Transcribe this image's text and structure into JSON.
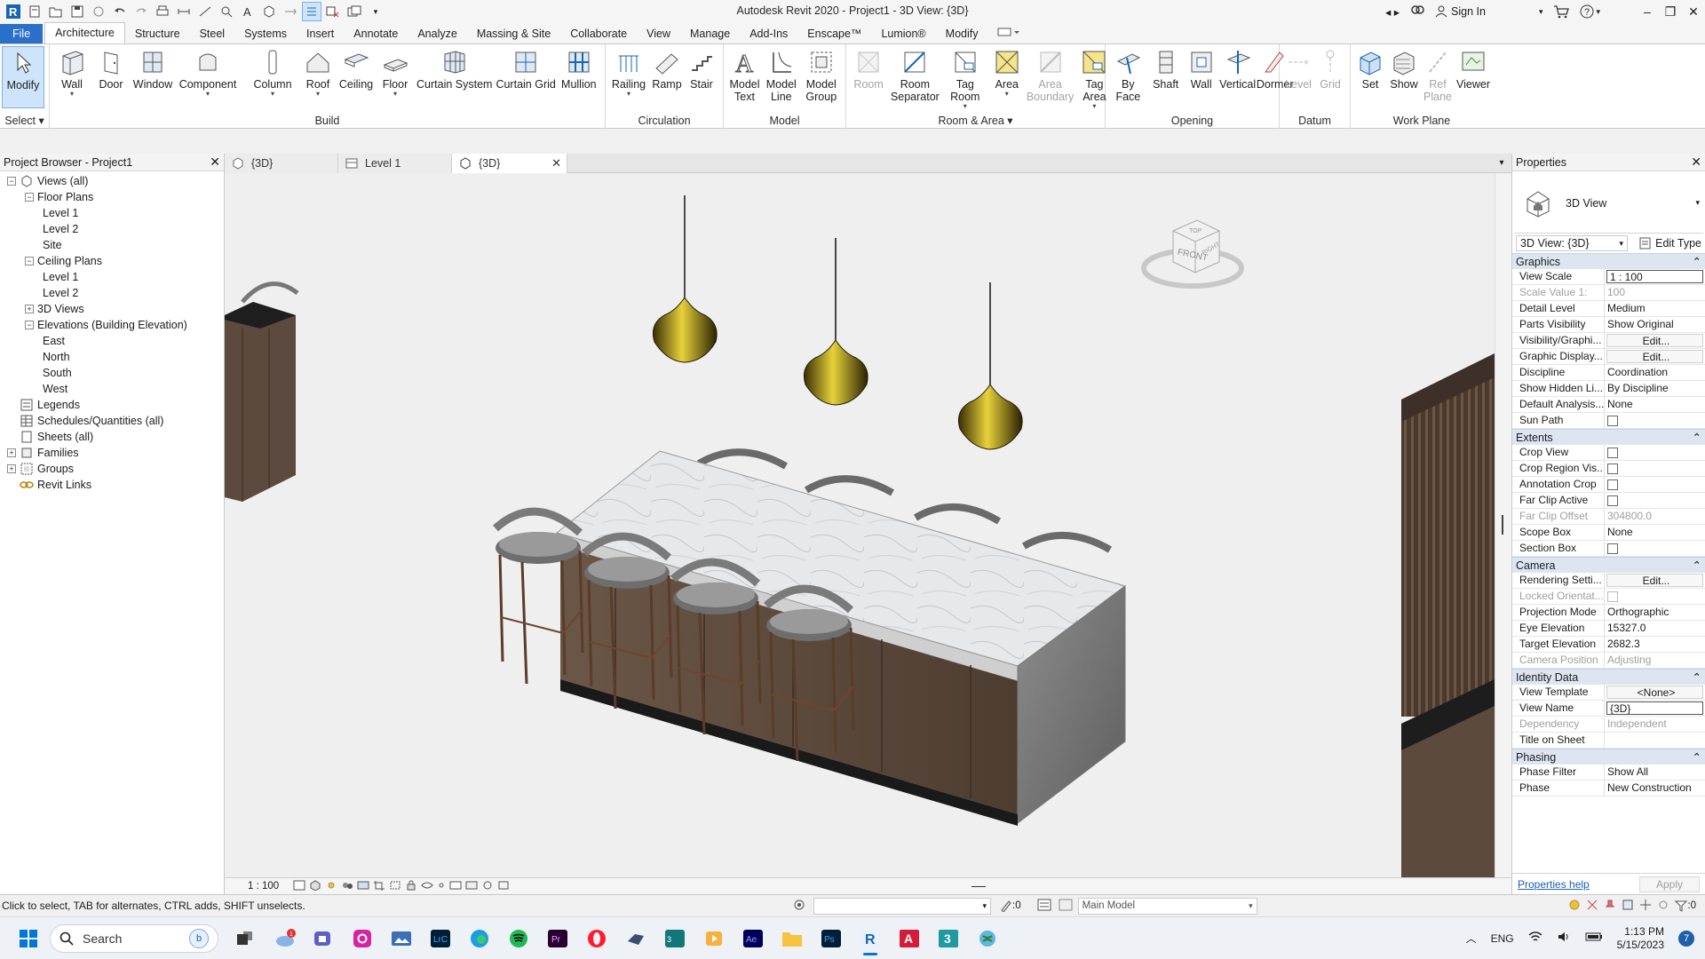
{
  "title": "Autodesk Revit 2020 - Project1 - 3D View: {3D}",
  "account": {
    "sign_in": "Sign In"
  },
  "tabs": [
    "File",
    "Architecture",
    "Structure",
    "Steel",
    "Systems",
    "Insert",
    "Annotate",
    "Analyze",
    "Massing & Site",
    "Collaborate",
    "View",
    "Manage",
    "Add-Ins",
    "Enscape™",
    "Lumion®",
    "Modify"
  ],
  "ribbon": {
    "select": {
      "modify": "Modify",
      "label": "Select"
    },
    "build": {
      "buttons": [
        "Wall",
        "Door",
        "Window",
        "Component",
        "Column",
        "Roof",
        "Ceiling",
        "Floor",
        "Curtain System",
        "Curtain Grid",
        "Mullion"
      ],
      "label": "Build"
    },
    "circulation": {
      "buttons": [
        "Railing",
        "Ramp",
        "Stair"
      ],
      "label": "Circulation"
    },
    "model": {
      "buttons": [
        "Model Text",
        "Model Line",
        "Model Group"
      ],
      "label": "Model"
    },
    "room_area": {
      "buttons": [
        "Room",
        "Room Separator",
        "Tag Room",
        "Area",
        "Area Boundary",
        "Tag Area"
      ],
      "label": "Room & Area"
    },
    "opening": {
      "buttons": [
        "By Face",
        "Shaft",
        "Wall",
        "Vertical",
        "Dormer"
      ],
      "label": "Opening"
    },
    "datum": {
      "buttons": [
        "Level",
        "Grid"
      ],
      "label": "Datum"
    },
    "work_plane": {
      "buttons": [
        "Set",
        "Show",
        "Ref Plane",
        "Viewer"
      ],
      "label": "Work Plane"
    }
  },
  "project_browser": {
    "title": "Project Browser - Project1",
    "nodes": [
      {
        "label": "Views (all)",
        "level": 0,
        "exp": "−"
      },
      {
        "label": "Floor Plans",
        "level": 1,
        "exp": "−"
      },
      {
        "label": "Level 1",
        "level": 2
      },
      {
        "label": "Level 2",
        "level": 2
      },
      {
        "label": "Site",
        "level": 2
      },
      {
        "label": "Ceiling Plans",
        "level": 1,
        "exp": "−"
      },
      {
        "label": "Level 1",
        "level": 2
      },
      {
        "label": "Level 2",
        "level": 2
      },
      {
        "label": "3D Views",
        "level": 1,
        "exp": "+"
      },
      {
        "label": "Elevations (Building Elevation)",
        "level": 1,
        "exp": "−"
      },
      {
        "label": "East",
        "level": 2
      },
      {
        "label": "North",
        "level": 2
      },
      {
        "label": "South",
        "level": 2
      },
      {
        "label": "West",
        "level": 2
      },
      {
        "label": "Legends",
        "level": 0,
        "icon": "legend"
      },
      {
        "label": "Schedules/Quantities (all)",
        "level": 0,
        "icon": "schedule"
      },
      {
        "label": "Sheets (all)",
        "level": 0,
        "icon": "sheet"
      },
      {
        "label": "Families",
        "level": 0,
        "exp": "+",
        "icon": "family"
      },
      {
        "label": "Groups",
        "level": 0,
        "exp": "+",
        "icon": "group"
      },
      {
        "label": "Revit Links",
        "level": 0,
        "icon": "link"
      }
    ]
  },
  "view_tabs": [
    "{3D}",
    "Level 1",
    "{3D}"
  ],
  "view_control": {
    "scale": "1 : 100",
    "count": "0"
  },
  "properties": {
    "title": "Properties",
    "type_name": "3D View",
    "selector": "3D View: {3D}",
    "edit_type": "Edit Type",
    "sections": [
      {
        "name": "Graphics",
        "rows": [
          {
            "k": "View Scale",
            "v": "1 : 100",
            "box": true
          },
          {
            "k": "Scale Value    1:",
            "v": "100",
            "dim": true
          },
          {
            "k": "Detail Level",
            "v": "Medium"
          },
          {
            "k": "Parts Visibility",
            "v": "Show Original"
          },
          {
            "k": "Visibility/Graphi...",
            "v": "Edit...",
            "btn": true
          },
          {
            "k": "Graphic Display...",
            "v": "Edit...",
            "btn": true
          },
          {
            "k": "Discipline",
            "v": "Coordination"
          },
          {
            "k": "Show Hidden Li...",
            "v": "By Discipline"
          },
          {
            "k": "Default Analysis...",
            "v": "None"
          },
          {
            "k": "Sun Path",
            "v": "",
            "check": true
          }
        ]
      },
      {
        "name": "Extents",
        "rows": [
          {
            "k": "Crop View",
            "v": "",
            "check": true
          },
          {
            "k": "Crop Region Vis...",
            "v": "",
            "check": true
          },
          {
            "k": "Annotation Crop",
            "v": "",
            "check": true
          },
          {
            "k": "Far Clip Active",
            "v": "",
            "check": true
          },
          {
            "k": "Far Clip Offset",
            "v": "304800.0",
            "dim": true
          },
          {
            "k": "Scope Box",
            "v": "None"
          },
          {
            "k": "Section Box",
            "v": "",
            "check": true
          }
        ]
      },
      {
        "name": "Camera",
        "rows": [
          {
            "k": "Rendering Setti...",
            "v": "Edit...",
            "btn": true
          },
          {
            "k": "Locked Orientat...",
            "v": "",
            "check": true,
            "dim": true
          },
          {
            "k": "Projection Mode",
            "v": "Orthographic"
          },
          {
            "k": "Eye Elevation",
            "v": "15327.0"
          },
          {
            "k": "Target Elevation",
            "v": "2682.3"
          },
          {
            "k": "Camera Position",
            "v": "Adjusting",
            "dim": true
          }
        ]
      },
      {
        "name": "Identity Data",
        "rows": [
          {
            "k": "View Template",
            "v": "<None>",
            "btn": true
          },
          {
            "k": "View Name",
            "v": "{3D}",
            "box": true
          },
          {
            "k": "Dependency",
            "v": "Independent",
            "dim": true
          },
          {
            "k": "Title on Sheet",
            "v": ""
          }
        ]
      },
      {
        "name": "Phasing",
        "rows": [
          {
            "k": "Phase Filter",
            "v": "Show All"
          },
          {
            "k": "Phase",
            "v": "New Construction"
          }
        ]
      }
    ],
    "help": "Properties help",
    "apply": "Apply"
  },
  "viewcube": {
    "top": "TOP",
    "front": "FRONT",
    "right": "RIGHT"
  },
  "status": {
    "message": "Click to select, TAB for alternates, CTRL adds, SHIFT unselects.",
    "count": ":0",
    "model": "Main Model",
    "filter": ":0"
  },
  "taskbar": {
    "search": "Search",
    "lang": "ENG",
    "time": "1:13 PM",
    "date": "5/15/2023",
    "badge": "7",
    "weather_badge": "1"
  },
  "colors": {
    "file_tab": "#2a6fc9",
    "accent": "#0078d4",
    "section": "#dde6f0"
  }
}
